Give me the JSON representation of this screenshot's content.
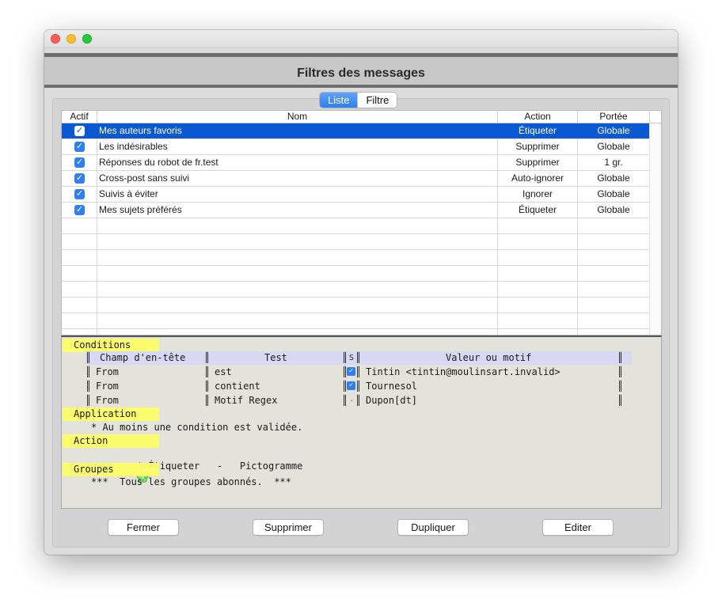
{
  "window": {
    "title": "Filtres des messages"
  },
  "tabs": [
    {
      "label": "Liste",
      "active": true
    },
    {
      "label": "Filtre",
      "active": false
    }
  ],
  "table": {
    "columns": [
      "Actif",
      "Nom",
      "Action",
      "Portée"
    ],
    "rows": [
      {
        "actif": true,
        "nom": "Mes auteurs favoris",
        "action": "Étiqueter",
        "portee": "Globale",
        "selected": true
      },
      {
        "actif": true,
        "nom": "Les indésirables",
        "action": "Supprimer",
        "portee": "Globale",
        "selected": false
      },
      {
        "actif": true,
        "nom": "Réponses du robot de fr.test",
        "action": "Supprimer",
        "portee": "1 gr.",
        "selected": false
      },
      {
        "actif": true,
        "nom": "Cross-post sans suivi",
        "action": "Auto-ignorer",
        "portee": "Globale",
        "selected": false
      },
      {
        "actif": true,
        "nom": "Suivis à éviter",
        "action": "Ignorer",
        "portee": "Globale",
        "selected": false
      },
      {
        "actif": true,
        "nom": "Mes sujets préférés",
        "action": "Étiqueter",
        "portee": "Globale",
        "selected": false
      }
    ],
    "checkmark": "✓"
  },
  "details": {
    "conditions_label": "Conditions",
    "cond_headers": {
      "champ": "Champ d'en-tête",
      "test": "Test",
      "s": "S",
      "valeur": "Valeur ou motif"
    },
    "conditions": [
      {
        "champ": "From",
        "test": "est",
        "s_checked": true,
        "valeur": "Tintin <tintin@moulinsart.invalid>"
      },
      {
        "champ": "From",
        "test": "contient",
        "s_checked": true,
        "valeur": "Tournesol"
      },
      {
        "champ": "From",
        "test": "Motif Regex",
        "s_checked": false,
        "valeur": "Dupon[dt]"
      }
    ],
    "application_label": "Application",
    "application_text": "* Au moins une condition est validée.",
    "action_label": "Action",
    "action_text": "* Étiqueter   -   Pictogramme",
    "action_icon": "green-flower-icon",
    "groupes_label": "Groupes",
    "groupes_text": "***  Tous les groupes abonnés.  ***"
  },
  "buttons": {
    "fermer": "Fermer",
    "supprimer": "Supprimer",
    "dupliquer": "Dupliquer",
    "editer": "Editer"
  },
  "colors": {
    "selection": "#0a59d3",
    "section_highlight": "#fbfb6e",
    "header_row": "#d8d8f4",
    "accent": "#2f7ff1"
  }
}
